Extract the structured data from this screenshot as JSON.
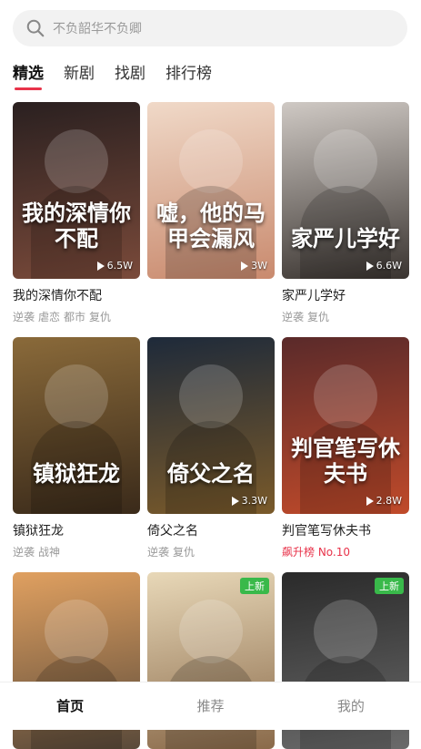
{
  "search": {
    "placeholder": "不负韶华不负卿"
  },
  "tabs": [
    {
      "label": "精选",
      "active": true
    },
    {
      "label": "新剧",
      "active": false
    },
    {
      "label": "找剧",
      "active": false
    },
    {
      "label": "排行榜",
      "active": false
    }
  ],
  "dramas": [
    {
      "title": "我的深情你不配",
      "poster_text": "我的深情你不配",
      "views": "6.5W",
      "tags": [
        "逆袭",
        "虐恋",
        "都市",
        "复仇"
      ],
      "rank": "",
      "badge": "",
      "bg": [
        "#2a2020",
        "#7a4a3a"
      ]
    },
    {
      "title": "",
      "poster_text": "嘘，他的马甲会漏风",
      "views": "3W",
      "tags": [],
      "rank": "",
      "badge": "",
      "bg": [
        "#f0d9c8",
        "#c98a6e"
      ]
    },
    {
      "title": "家严儿学好",
      "poster_text": "家严儿学好",
      "views": "6.6W",
      "tags": [
        "逆袭",
        "复仇"
      ],
      "rank": "",
      "badge": "",
      "bg": [
        "#cfc9c4",
        "#3a3430"
      ]
    },
    {
      "title": "镇狱狂龙",
      "poster_text": "镇狱狂龙",
      "views": "",
      "tags": [
        "逆袭",
        "战神"
      ],
      "rank": "",
      "badge": "",
      "bg": [
        "#8a6a3a",
        "#3a2a1a"
      ]
    },
    {
      "title": "倚父之名",
      "poster_text": "倚父之名",
      "views": "3.3W",
      "tags": [
        "逆袭",
        "复仇"
      ],
      "rank": "",
      "badge": "",
      "bg": [
        "#1e2a3a",
        "#7a5a2a"
      ]
    },
    {
      "title": "判官笔写休夫书",
      "poster_text": "判官笔写休夫书",
      "views": "2.8W",
      "tags": [],
      "rank": "飙升榜 No.10",
      "badge": "",
      "bg": [
        "#5a2a2a",
        "#c04a2a"
      ]
    },
    {
      "title": "",
      "poster_text": "",
      "views": "",
      "tags": [],
      "rank": "",
      "badge": "",
      "bg": [
        "#e0a060",
        "#5a4a3a"
      ]
    },
    {
      "title": "",
      "poster_text": "",
      "views": "",
      "tags": [],
      "rank": "",
      "badge": "上新",
      "bg": [
        "#e8d8b8",
        "#8a6a4a"
      ]
    },
    {
      "title": "",
      "poster_text": "",
      "views": "",
      "tags": [],
      "rank": "",
      "badge": "上新",
      "bg": [
        "#2a2a2a",
        "#6a6a6a"
      ]
    }
  ],
  "bottom_nav": [
    {
      "label": "首页",
      "active": true
    },
    {
      "label": "推荐",
      "active": false
    },
    {
      "label": "我的",
      "active": false
    }
  ],
  "colors": {
    "accent": "#e8334a",
    "new_badge": "#39b94a"
  }
}
